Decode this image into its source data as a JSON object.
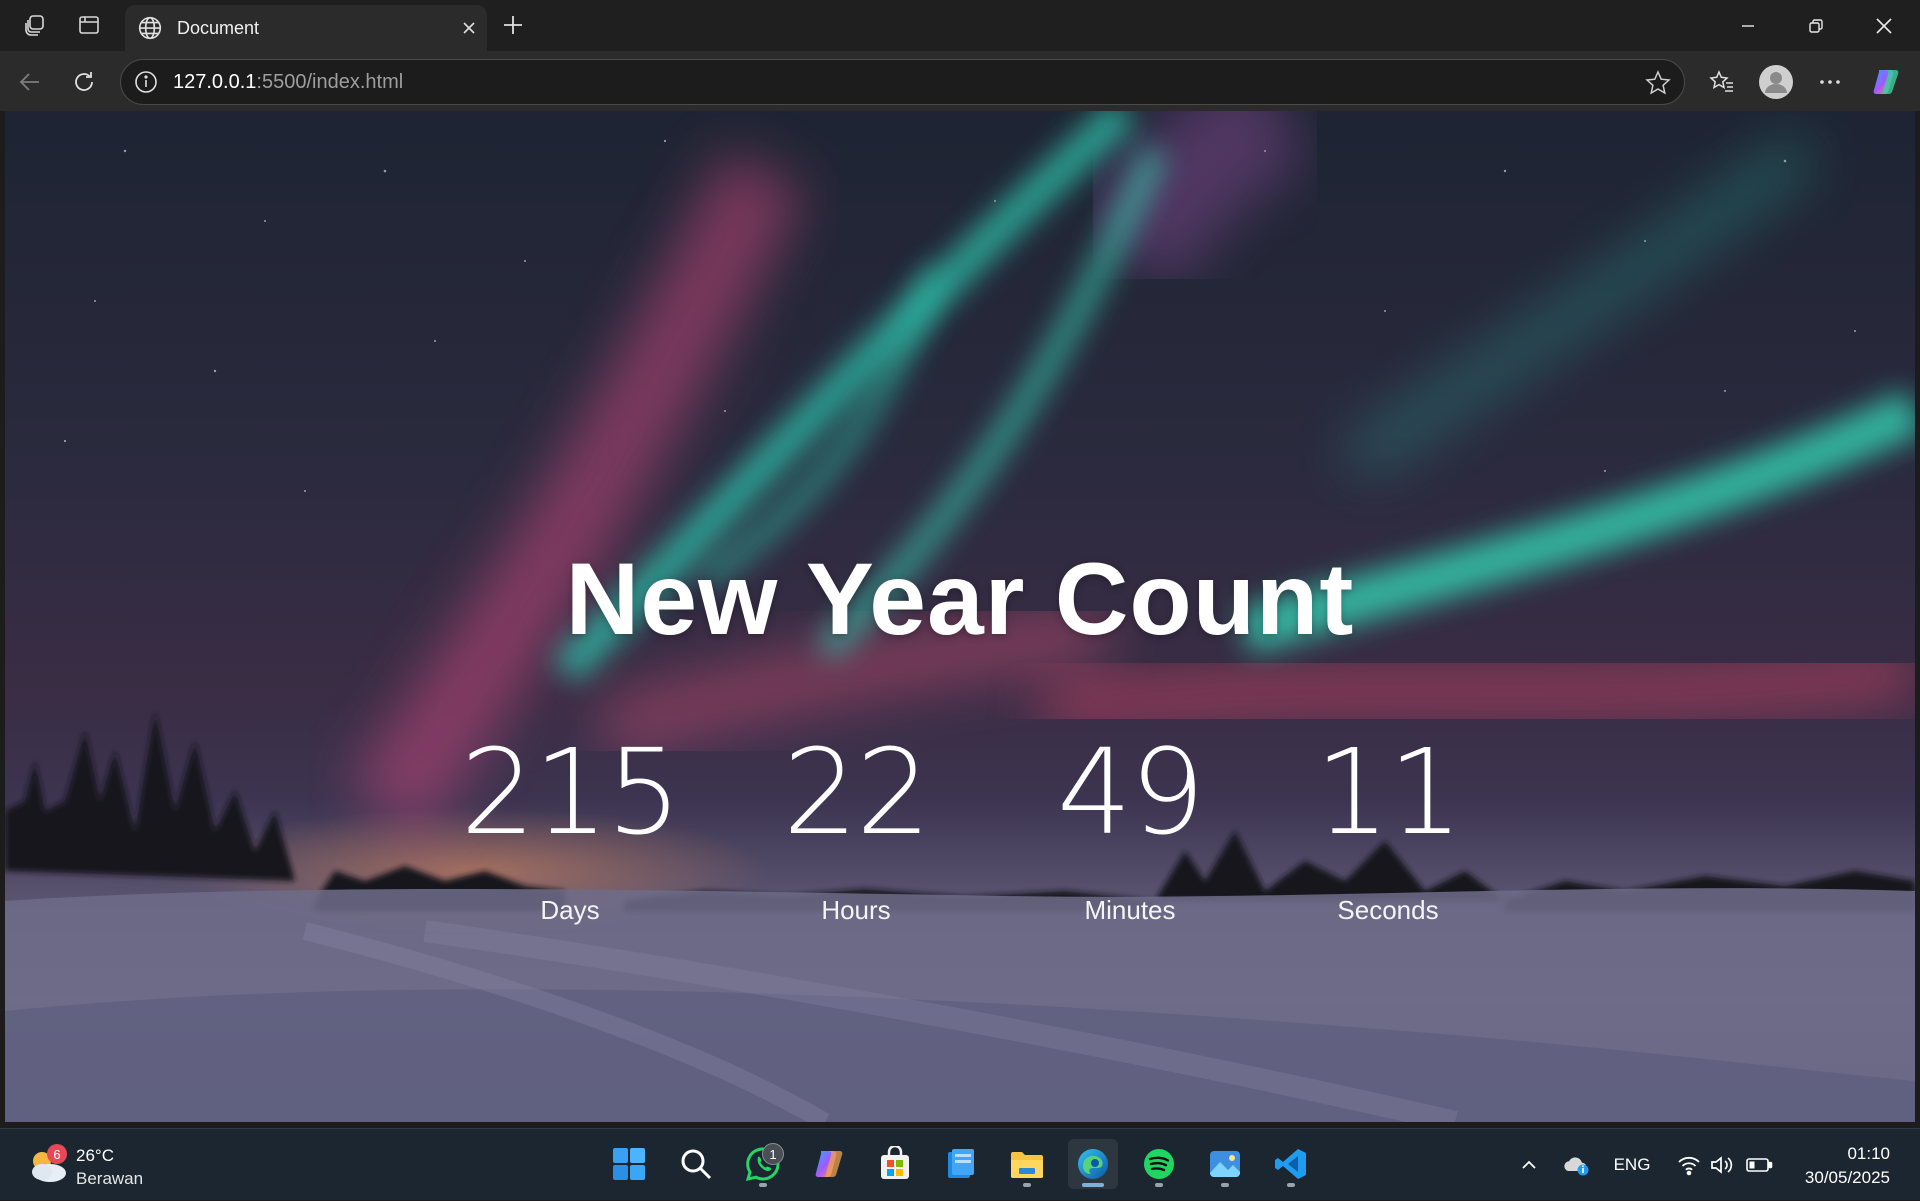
{
  "browser": {
    "tab_title": "Document",
    "url_host": "127.0.0.1",
    "url_rest": ":5500/index.html"
  },
  "page": {
    "title": "New Year Count",
    "countdown": [
      {
        "value": "215",
        "label": "Days"
      },
      {
        "value": "22",
        "label": "Hours"
      },
      {
        "value": "49",
        "label": "Minutes"
      },
      {
        "value": "11",
        "label": "Seconds"
      }
    ]
  },
  "taskbar": {
    "weather": {
      "badge": "6",
      "temp": "26°C",
      "condition": "Berawan"
    },
    "whatsapp_badge": "1",
    "language": "ENG",
    "time": "01:10",
    "date": "30/05/2025",
    "apps": [
      "start-icon",
      "search-icon",
      "whatsapp-icon",
      "copilot-icon",
      "store-icon",
      "widgets-app-icon",
      "file-explorer-icon",
      "edge-icon",
      "spotify-icon",
      "photos-icon",
      "vscode-icon"
    ]
  },
  "colors": {
    "aurora_green": "#2fd3b4",
    "aurora_pink": "#e0557a",
    "taskbar_bg": "#1b2630",
    "browser_bg": "#2b2b2b"
  }
}
